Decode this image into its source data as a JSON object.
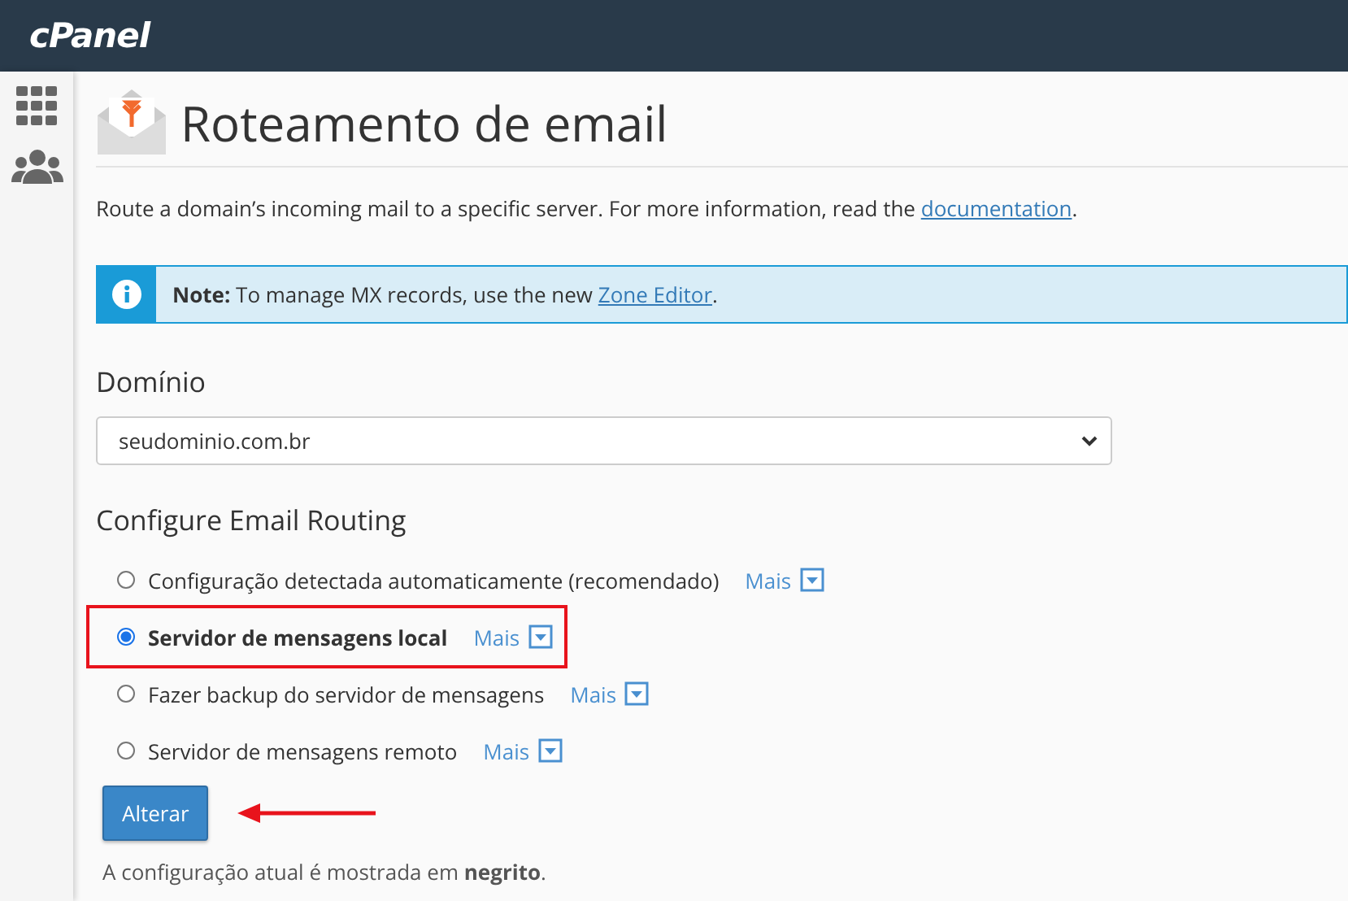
{
  "header": {
    "logo": "cPanel"
  },
  "page": {
    "title": "Roteamento de email"
  },
  "intro": {
    "text": "Route a domain’s incoming mail to a specific server. For more information, read the ",
    "link": "documentation",
    "after": "."
  },
  "note": {
    "text": "**Note:** To manage MX records, use the new ",
    "link": "Zone Editor",
    "after": "."
  },
  "domain": {
    "label": "Domínio",
    "value": "seudominio.com.br"
  },
  "routing": {
    "heading": "Configure Email Routing",
    "options": [
      {
        "label": "Configuração detectada automaticamente (recomendado)",
        "more": "Mais",
        "selected": false,
        "current": false,
        "highlighted": false
      },
      {
        "label": "Servidor de mensagens local",
        "more": "Mais",
        "selected": true,
        "current": true,
        "highlighted": true
      },
      {
        "label": "Fazer backup do servidor de mensagens",
        "more": "Mais",
        "selected": false,
        "current": false,
        "highlighted": false
      },
      {
        "label": "Servidor de mensagens remoto",
        "more": "Mais",
        "selected": false,
        "current": false,
        "highlighted": false
      }
    ],
    "button": "Alterar",
    "footnote": "A configuração atual é mostrada em **negrito**."
  }
}
